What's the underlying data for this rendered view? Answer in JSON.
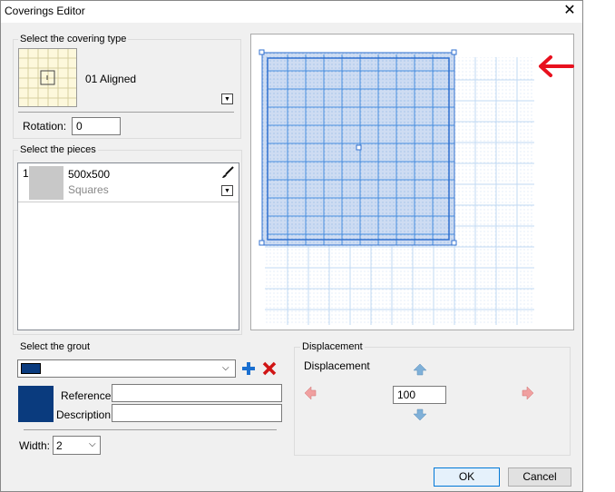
{
  "window": {
    "title": "Coverings Editor",
    "close_glyph": "✕"
  },
  "covering_type": {
    "group_label": "Select the covering type",
    "selected_name": "01 Aligned",
    "rotation_label": "Rotation:",
    "rotation_value": "0"
  },
  "pieces": {
    "group_label": "Select the pieces",
    "items": [
      {
        "index": "1",
        "name": "500x500",
        "shape": "Squares"
      }
    ]
  },
  "grout": {
    "group_label": "Select the grout",
    "color": "#0a3b7e",
    "reference_label": "Reference",
    "reference_value": "",
    "description_label": "Description",
    "description_value": "",
    "width_label": "Width:",
    "width_value": "2"
  },
  "displacement": {
    "group_label": "Displacement",
    "inner_label": "Displacement",
    "value": "100"
  },
  "buttons": {
    "ok": "OK",
    "cancel": "Cancel"
  },
  "colors": {
    "arrow": "#e8101e",
    "selection": "#3070d0",
    "tile_grid": "#4a8fe0"
  }
}
